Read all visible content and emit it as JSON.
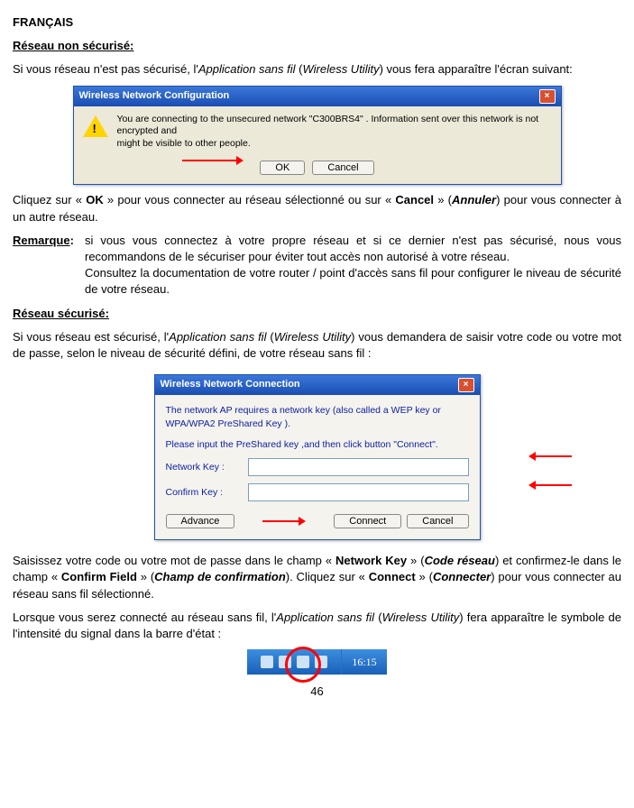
{
  "header": {
    "lang": "FRANÇAIS"
  },
  "s1": {
    "title": "Réseau non sécurisé:",
    "intro_a": "Si vous réseau n'est pas sécurisé, l'",
    "intro_b": "Application sans fil",
    "intro_c": " (",
    "intro_d": "Wireless Utility",
    "intro_e": ") vous fera apparaître l'écran suivant:"
  },
  "dlg1": {
    "title": "Wireless Network Configuration",
    "msg_line1": "You are connecting to the unsecured network \"C300BRS4\" . Information sent over this network is not encrypted and",
    "msg_line2": "might be visible to other people.",
    "ok": "OK",
    "cancel": "Cancel"
  },
  "s1_after": {
    "a": "Cliquez sur « ",
    "b": "OK",
    "c": " » pour vous connecter au réseau sélectionné ou sur « ",
    "d": "Cancel",
    "e": " » (",
    "f": "Annuler",
    "g": ") pour vous connecter à un autre réseau."
  },
  "remark": {
    "label": "Remarque",
    "colon": ":",
    "p1": " si vous vous connectez à votre propre réseau et si ce dernier n'est pas sécurisé, nous vous recommandons de le sécuriser pour éviter tout accès non autorisé à votre réseau.",
    "p2": "Consultez la documentation de votre router / point d'accès sans fil pour configurer le niveau de sécurité de votre réseau."
  },
  "s2": {
    "title": "Réseau sécurisé:",
    "intro_a": "Si vous réseau est sécurisé, l'",
    "intro_b": "Application sans fil",
    "intro_c": " (",
    "intro_d": "Wireless Utility",
    "intro_e": ") vous demandera de saisir votre code ou votre mot de passe, selon le niveau de sécurité défini, de votre réseau sans fil :"
  },
  "dlg2": {
    "title": "Wireless Network Connection",
    "msg1": "The network AP requires a network key (also called a WEP key or WPA/WPA2 PreShared Key ).",
    "msg2": "Please input the PreShared key ,and then click button \"Connect\".",
    "label_key": "Network Key :",
    "label_confirm": "Confirm Key :",
    "btn_advance": "Advance",
    "btn_connect": "Connect",
    "btn_cancel": "Cancel"
  },
  "s2_after": {
    "a": "Saisissez votre code ou votre mot de passe dans le champ « ",
    "b": "Network Key",
    "c": " » (",
    "d": "Code réseau",
    "e": ") et confirmez-le dans le champ « ",
    "f": "Confirm Field",
    "g": " » (",
    "h": "Champ de confirmation",
    "i": "). Cliquez sur « ",
    "j": "Connect",
    "k": " » (",
    "l": "Connecter",
    "m": ") pour vous connecter au réseau sans fil sélectionné."
  },
  "s3": {
    "a": "Lorsque vous serez connecté au réseau sans fil, l'",
    "b": "Application sans fil",
    "c": " (",
    "d": "Wireless Utility",
    "e": ") fera apparaître le symbole de l'intensité du signal dans la barre d'état :"
  },
  "tray": {
    "time": "16:15"
  },
  "footer": {
    "page": "46"
  }
}
